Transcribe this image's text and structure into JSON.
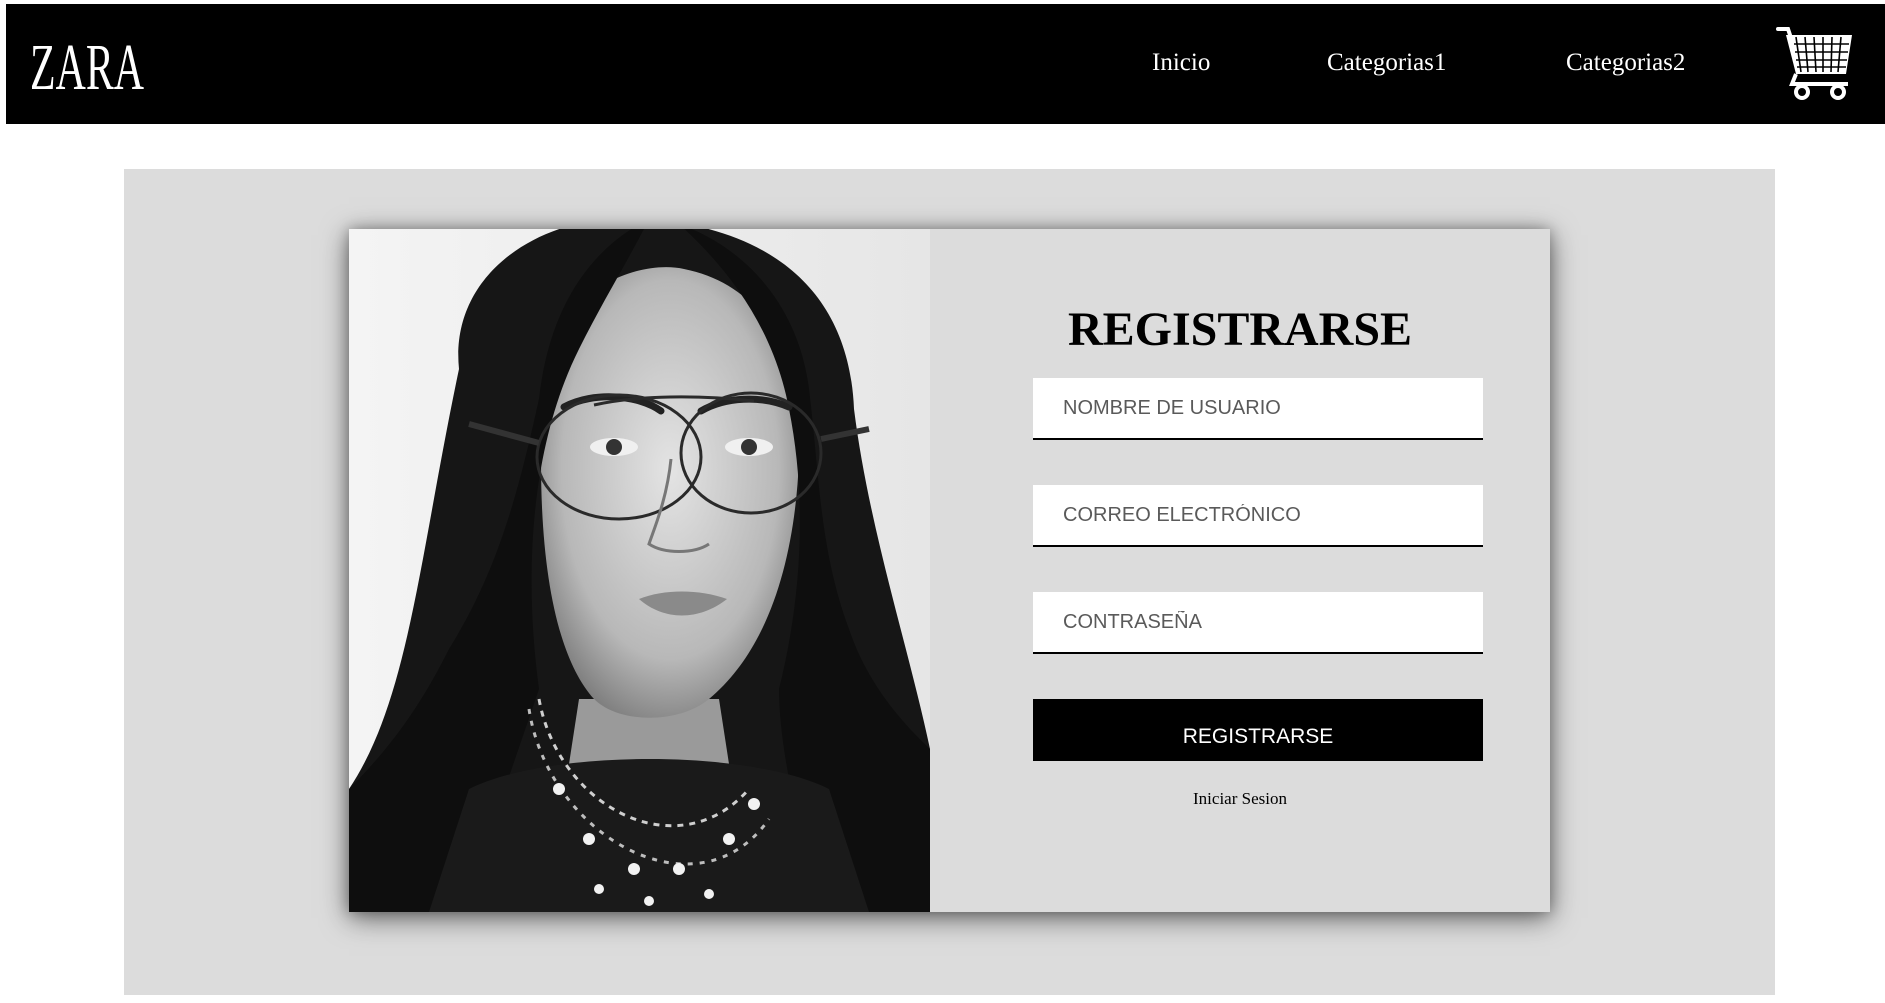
{
  "brand": {
    "logo_text": "ZARA"
  },
  "nav": {
    "items": [
      {
        "label": "Inicio"
      },
      {
        "label": "Categorias1"
      },
      {
        "label": "Categorias2"
      }
    ],
    "cart_icon": "shopping-cart-icon"
  },
  "form": {
    "title": "REGISTRARSE",
    "username_placeholder": "NOMBRE DE USUARIO",
    "email_placeholder": "CORREO ELECTRÓNICO",
    "password_placeholder": "CONTRASEÑA",
    "submit_label": "REGISTRARSE",
    "login_link": "Iniciar Sesion"
  },
  "colors": {
    "navbar": "#000000",
    "stage": "#dcdcdc",
    "button": "#000000",
    "input": "#ffffff"
  }
}
